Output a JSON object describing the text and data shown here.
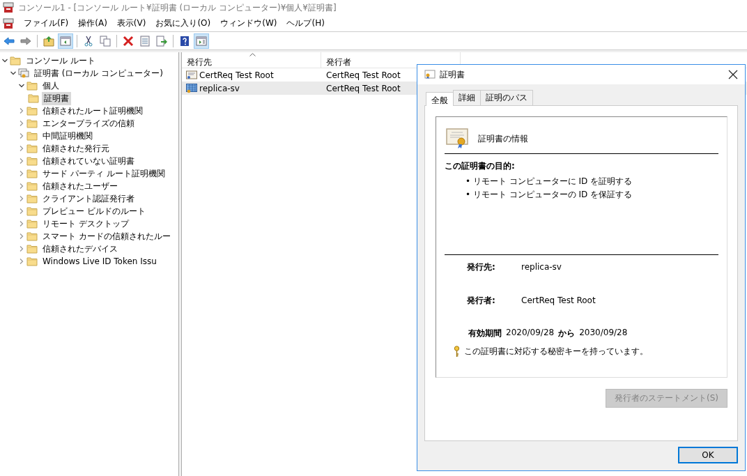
{
  "window": {
    "title": "コンソール1 - [コンソール ルート¥証明書 (ローカル コンピューター)¥個人¥証明書]"
  },
  "menu": [
    "ファイル(F)",
    "操作(A)",
    "表示(V)",
    "お気に入り(O)",
    "ウィンドウ(W)",
    "ヘルプ(H)"
  ],
  "toolbar": [
    [
      {
        "kind": "back",
        "pressed": false
      },
      {
        "kind": "forward",
        "pressed": false
      }
    ],
    [
      {
        "kind": "up",
        "pressed": false
      },
      {
        "kind": "pane",
        "pressed": true
      }
    ],
    [
      {
        "kind": "cut",
        "pressed": false
      },
      {
        "kind": "copy",
        "pressed": false
      }
    ],
    [
      {
        "kind": "delete",
        "pressed": false
      },
      {
        "kind": "properties",
        "pressed": false
      },
      {
        "kind": "export",
        "pressed": false
      }
    ],
    [
      {
        "kind": "help",
        "pressed": false
      },
      {
        "kind": "action",
        "pressed": true
      }
    ]
  ],
  "tree": [
    {
      "label": "コンソール ルート",
      "kind": "folder",
      "selected": false,
      "expanded": true,
      "children": [
        {
          "label": "証明書 (ローカル コンピューター)",
          "kind": "store",
          "selected": false,
          "expanded": true,
          "children": [
            {
              "label": "個人",
              "kind": "folder",
              "selected": false,
              "expanded": true,
              "children": [
                {
                  "label": "証明書",
                  "kind": "folder",
                  "selected": true
                }
              ]
            },
            {
              "label": "信頼されたルート証明機関",
              "kind": "folder",
              "selected": false,
              "expanded": false
            },
            {
              "label": "エンタープライズの信頼",
              "kind": "folder",
              "selected": false,
              "expanded": false
            },
            {
              "label": "中間証明機関",
              "kind": "folder",
              "selected": false,
              "expanded": false
            },
            {
              "label": "信頼された発行元",
              "kind": "folder",
              "selected": false,
              "expanded": false
            },
            {
              "label": "信頼されていない証明書",
              "kind": "folder",
              "selected": false,
              "expanded": false
            },
            {
              "label": "サード パーティ ルート証明機関",
              "kind": "folder",
              "selected": false,
              "expanded": false
            },
            {
              "label": "信頼されたユーザー",
              "kind": "folder",
              "selected": false,
              "expanded": false
            },
            {
              "label": "クライアント認証発行者",
              "kind": "folder",
              "selected": false,
              "expanded": false
            },
            {
              "label": "プレビュー ビルドのルート",
              "kind": "folder",
              "selected": false,
              "expanded": false
            },
            {
              "label": "リモート デスクトップ",
              "kind": "folder",
              "selected": false,
              "expanded": false
            },
            {
              "label": "スマート カードの信頼されたルー",
              "kind": "folder",
              "selected": false,
              "expanded": false
            },
            {
              "label": "信頼されたデバイス",
              "kind": "folder",
              "selected": false,
              "expanded": false
            },
            {
              "label": "Windows Live ID Token Issu",
              "kind": "folder",
              "selected": false,
              "expanded": false
            }
          ]
        }
      ]
    }
  ],
  "table": {
    "columns": [
      "発行先",
      "発行者"
    ],
    "rows": [
      {
        "kind": "root",
        "subject": "CertReq Test Root",
        "issuer": "CertReq Test Root",
        "selected": false
      },
      {
        "kind": "leaf",
        "subject": "replica-sv",
        "issuer": "CertReq Test Root",
        "selected": true
      }
    ]
  },
  "dialog": {
    "title": "証明書",
    "tabs": [
      {
        "label": "全般",
        "selected": true
      },
      {
        "label": "詳細",
        "selected": false
      },
      {
        "label": "証明のパス",
        "selected": false
      }
    ],
    "heading": "証明書の情報",
    "purpose_label": "この証明書の目的:",
    "purposes": [
      "• リモート コンピューターに ID を証明する",
      "• リモート コンピューターの ID を保証する"
    ],
    "issued_to_label": "発行先:",
    "issued_to": "replica-sv",
    "issued_by_label": "発行者:",
    "issued_by": "CertReq Test Root",
    "validity_label": "有効期間",
    "valid_from": "2020/09/28",
    "valid_between": "から",
    "valid_to": "2030/09/28",
    "key_note": "この証明書に対応する秘密キーを持っています。",
    "statement_button": {
      "label": "発行者のステートメント(S)",
      "disabled": true
    },
    "ok_button": "OK"
  }
}
